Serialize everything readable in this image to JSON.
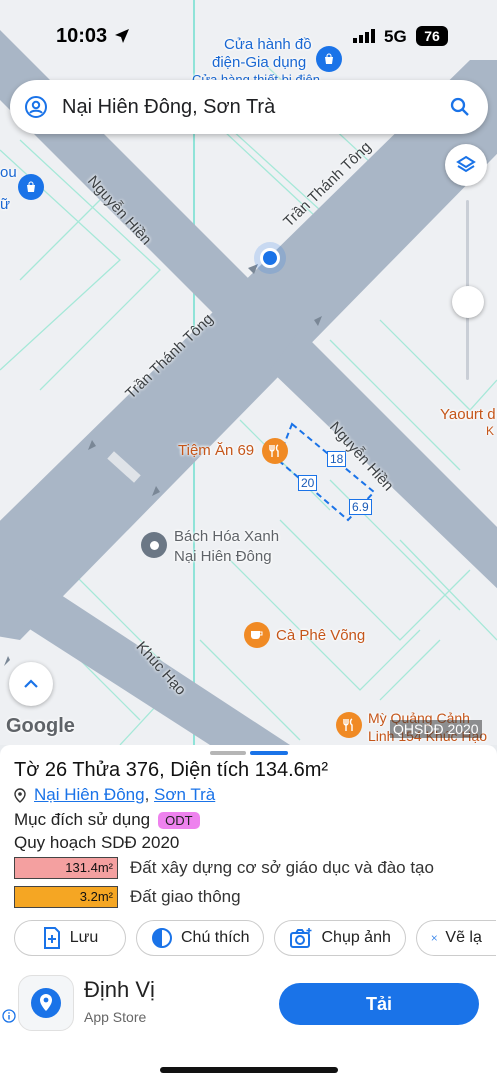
{
  "status_bar": {
    "time": "10:03",
    "network": "5G",
    "battery": "76"
  },
  "search": {
    "query": "Nại Hiên Đông, Sơn Trà"
  },
  "map": {
    "streets": {
      "nguyen_hien_top": "Nguyễn Hiền",
      "tran_thanh_tong_top": "Trần Thánh Tông",
      "tran_thanh_tong_mid": "Trần Thánh Tông",
      "nguyen_hien_right": "Nguyễn Hiền",
      "khuc_hao": "Khúc Hạo"
    },
    "pois": {
      "store_line1": "Cửa hành đồ",
      "store_line2": "điện-Gia dụng",
      "store_line3": "Cửa hàng thiết bị điện",
      "left_cut_1": "ou",
      "left_cut_2": "ữ",
      "tiem_an": "Tiệm Ăn 69",
      "bach_hoa_line1": "Bách Hóa Xanh",
      "bach_hoa_line2": "Nại Hiên Đông",
      "ca_phe": "Cà Phê Võng",
      "yaourt": "Yaourt d",
      "yaourt_2": "K",
      "my_quang_line1": "Mỳ Quảng Cảnh",
      "my_quang_line2": "Linh 154 Khúc Hạo"
    },
    "parcel_dims": {
      "side_a": "18",
      "side_b": "20",
      "side_c": "6.9"
    },
    "google_logo": "Google",
    "layer_tag": "QHSDĐ 2020"
  },
  "sheet": {
    "title": "Tờ 26 Thửa 376, Diện tích 134.6m²",
    "address_part1": "Nại Hiên Đông",
    "address_sep": ", ",
    "address_part2": "Sơn Trà",
    "purpose_label": "Mục đích sử dụng",
    "purpose_badge": "ODT",
    "planning_label": "Quy hoạch SDĐ 2020",
    "legend": [
      {
        "value": "131.4m²",
        "label": "Đất xây dựng cơ sở giáo dục và đào tạo",
        "color": "#f4a0a0"
      },
      {
        "value": "3.2m²",
        "label": "Đất giao thông",
        "color": "#f5a623"
      }
    ],
    "actions": {
      "save": "Lưu",
      "notes": "Chú thích",
      "screenshot": "Chụp ảnh",
      "draw": "Vẽ lạ"
    }
  },
  "ad": {
    "app_name": "Định Vị",
    "store": "App Store",
    "cta": "Tải"
  },
  "colors": {
    "accent": "#1a73e8",
    "road": "#a7b4c5",
    "parcel_line": "#7fe3c9"
  }
}
